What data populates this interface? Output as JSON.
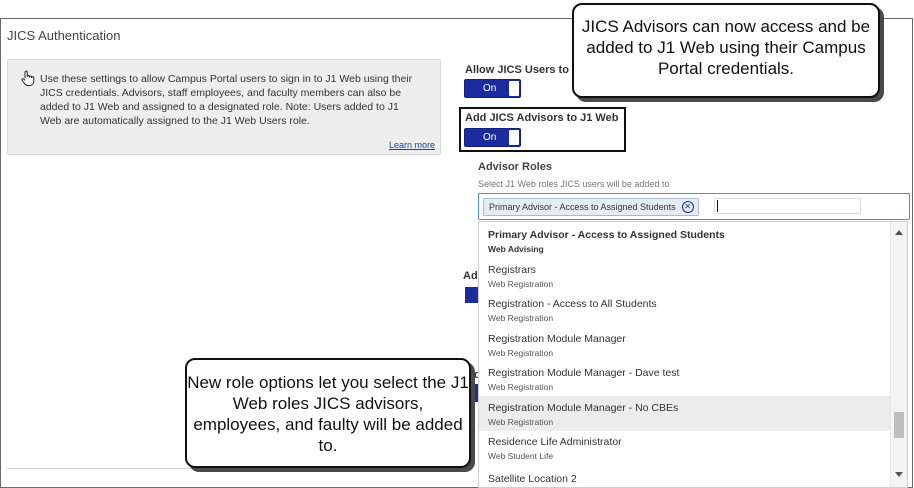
{
  "section_title": "JICS Authentication",
  "info": {
    "icon": "pointing-hand-icon",
    "text": "Use these settings to allow Campus Portal users to sign in to J1 Web using their JICS credentials. Advisors, staff employees, and faculty members can also be added to J1 Web and assigned to a designated role. Note: Users added to J1 Web are automatically assigned to the J1 Web Users role.",
    "learn_more": "Learn more"
  },
  "settings": {
    "allow_users_label": "Allow JICS Users to",
    "allow_users_toggle": "On",
    "add_advisors_label": "Add JICS Advisors to J1 Web",
    "add_advisors_toggle": "On",
    "partial_label": "Ad",
    "partial_label2": "d"
  },
  "advisor_roles": {
    "label": "Advisor Roles",
    "hint": "Select J1 Web roles JICS users will be added to",
    "selected_chip": "Primary Advisor - Access to Assigned Students",
    "search_value": ""
  },
  "dropdown_options": [
    {
      "title": "Primary Advisor - Access to Assigned Students",
      "sub": "Web Advising"
    },
    {
      "title": "Registrars",
      "sub": "Web Registration"
    },
    {
      "title": "Registration - Access to All Students",
      "sub": "Web Registration"
    },
    {
      "title": "Registration Module Manager",
      "sub": "Web Registration"
    },
    {
      "title": "Registration Module Manager - Dave test",
      "sub": "Web Registration"
    },
    {
      "title": "Registration Module Manager - No CBEs",
      "sub": "Web Registration"
    },
    {
      "title": "Residence Life Administrator",
      "sub": "Web Student Life"
    },
    {
      "title": "Satellite Location 2",
      "sub": ""
    }
  ],
  "callouts": {
    "top": "JICS Advisors can now access and be added to J1 Web using their Campus Portal credentials.",
    "bottom": "New role options let you select the J1 Web roles JICS advisors, employees, and faulty will be added to."
  },
  "colors": {
    "toggle_on": "#1d2c9c",
    "link": "#1a3fa6",
    "select_border": "#4e8fd6",
    "hover_row": "#ececec"
  }
}
